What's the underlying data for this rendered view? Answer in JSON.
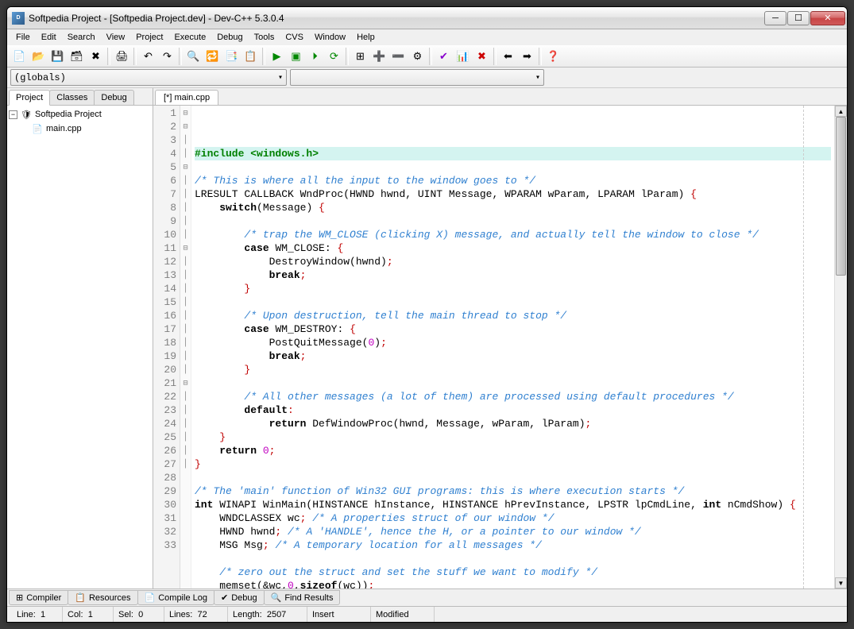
{
  "title": "Softpedia Project - [Softpedia Project.dev] - Dev-C++ 5.3.0.4",
  "menubar": [
    "File",
    "Edit",
    "Search",
    "View",
    "Project",
    "Execute",
    "Debug",
    "Tools",
    "CVS",
    "Window",
    "Help"
  ],
  "combo": {
    "globals": "(globals)"
  },
  "left_tabs": [
    "Project",
    "Classes",
    "Debug"
  ],
  "tree": {
    "root": "Softpedia Project",
    "file": "main.cpp"
  },
  "editor_tab": "[*] main.cpp",
  "bottom_tabs": [
    {
      "icon": "⊞",
      "label": "Compiler"
    },
    {
      "icon": "📋",
      "label": "Resources"
    },
    {
      "icon": "📄",
      "label": "Compile Log"
    },
    {
      "icon": "✔",
      "label": "Debug"
    },
    {
      "icon": "🔍",
      "label": "Find Results"
    }
  ],
  "status": {
    "line_label": "Line:",
    "line": "1",
    "col_label": "Col:",
    "col": "1",
    "sel_label": "Sel:",
    "sel": "0",
    "lines_label": "Lines:",
    "lines": "72",
    "length_label": "Length:",
    "length": "2507",
    "insert": "Insert",
    "modified": "Modified"
  },
  "code": [
    {
      "n": 1,
      "fold": " ",
      "t": "pre",
      "txt": "#include <windows.h>",
      "hl": true
    },
    {
      "n": 2,
      "fold": " ",
      "t": "",
      "txt": ""
    },
    {
      "n": 3,
      "fold": " ",
      "t": "cmt",
      "txt": "/* This is where all the input to the window goes to */"
    },
    {
      "n": 4,
      "fold": "⊟",
      "segs": [
        [
          "",
          "LRESULT CALLBACK WndProc(HWND hwnd, UINT Message, WPARAM wParam, LPARAM lParam) "
        ],
        [
          "op",
          "{"
        ]
      ]
    },
    {
      "n": 5,
      "fold": "⊟",
      "segs": [
        [
          "",
          "    "
        ],
        [
          "kw",
          "switch"
        ],
        [
          "",
          "(Message) "
        ],
        [
          "op",
          "{"
        ]
      ]
    },
    {
      "n": 6,
      "fold": "│",
      "t": "",
      "txt": ""
    },
    {
      "n": 7,
      "fold": "│",
      "t": "cmt",
      "txt": "        /* trap the WM_CLOSE (clicking X) message, and actually tell the window to close */"
    },
    {
      "n": 8,
      "fold": "⊟",
      "segs": [
        [
          "",
          "        "
        ],
        [
          "kw",
          "case"
        ],
        [
          "",
          " WM_CLOSE: "
        ],
        [
          "op",
          "{"
        ]
      ]
    },
    {
      "n": 9,
      "fold": "│",
      "segs": [
        [
          "",
          "            DestroyWindow(hwnd)"
        ],
        [
          "op",
          ";"
        ]
      ]
    },
    {
      "n": 10,
      "fold": "│",
      "segs": [
        [
          "",
          "            "
        ],
        [
          "kw",
          "break"
        ],
        [
          "op",
          ";"
        ]
      ]
    },
    {
      "n": 11,
      "fold": "│",
      "segs": [
        [
          "",
          "        "
        ],
        [
          "op",
          "}"
        ]
      ]
    },
    {
      "n": 12,
      "fold": "│",
      "t": "",
      "txt": ""
    },
    {
      "n": 13,
      "fold": "│",
      "t": "cmt",
      "txt": "        /* Upon destruction, tell the main thread to stop */"
    },
    {
      "n": 14,
      "fold": "⊟",
      "segs": [
        [
          "",
          "        "
        ],
        [
          "kw",
          "case"
        ],
        [
          "",
          " WM_DESTROY: "
        ],
        [
          "op",
          "{"
        ]
      ]
    },
    {
      "n": 15,
      "fold": "│",
      "segs": [
        [
          "",
          "            PostQuitMessage("
        ],
        [
          "num",
          "0"
        ],
        [
          "",
          ")"
        ],
        [
          "op",
          ";"
        ]
      ]
    },
    {
      "n": 16,
      "fold": "│",
      "segs": [
        [
          "",
          "            "
        ],
        [
          "kw",
          "break"
        ],
        [
          "op",
          ";"
        ]
      ]
    },
    {
      "n": 17,
      "fold": "│",
      "segs": [
        [
          "",
          "        "
        ],
        [
          "op",
          "}"
        ]
      ]
    },
    {
      "n": 18,
      "fold": "│",
      "t": "",
      "txt": ""
    },
    {
      "n": 19,
      "fold": "│",
      "t": "cmt",
      "txt": "        /* All other messages (a lot of them) are processed using default procedures */"
    },
    {
      "n": 20,
      "fold": "│",
      "segs": [
        [
          "",
          "        "
        ],
        [
          "kw",
          "default"
        ],
        [
          "op",
          ":"
        ]
      ]
    },
    {
      "n": 21,
      "fold": "│",
      "segs": [
        [
          "",
          "            "
        ],
        [
          "kw",
          "return"
        ],
        [
          "",
          " DefWindowProc(hwnd, Message, wParam, lParam)"
        ],
        [
          "op",
          ";"
        ]
      ]
    },
    {
      "n": 22,
      "fold": "│",
      "segs": [
        [
          "",
          "    "
        ],
        [
          "op",
          "}"
        ]
      ]
    },
    {
      "n": 23,
      "fold": "│",
      "segs": [
        [
          "",
          "    "
        ],
        [
          "kw",
          "return"
        ],
        [
          "",
          " "
        ],
        [
          "num",
          "0"
        ],
        [
          "op",
          ";"
        ]
      ]
    },
    {
      "n": 24,
      "fold": " ",
      "segs": [
        [
          "op",
          "}"
        ]
      ]
    },
    {
      "n": 25,
      "fold": " ",
      "t": "",
      "txt": ""
    },
    {
      "n": 26,
      "fold": " ",
      "t": "cmt",
      "txt": "/* The 'main' function of Win32 GUI programs: this is where execution starts */"
    },
    {
      "n": 27,
      "fold": "⊟",
      "segs": [
        [
          "kw",
          "int"
        ],
        [
          "",
          " WINAPI WinMain(HINSTANCE hInstance, HINSTANCE hPrevInstance, LPSTR lpCmdLine, "
        ],
        [
          "kw",
          "int"
        ],
        [
          "",
          " nCmdShow) "
        ],
        [
          "op",
          "{"
        ]
      ]
    },
    {
      "n": 28,
      "fold": "│",
      "segs": [
        [
          "",
          "    WNDCLASSEX wc"
        ],
        [
          "op",
          ";"
        ],
        [
          "",
          " "
        ],
        [
          "cmt",
          "/* A properties struct of our window */"
        ]
      ]
    },
    {
      "n": 29,
      "fold": "│",
      "segs": [
        [
          "",
          "    HWND hwnd"
        ],
        [
          "op",
          ";"
        ],
        [
          "",
          " "
        ],
        [
          "cmt",
          "/* A 'HANDLE', hence the H, or a pointer to our window */"
        ]
      ]
    },
    {
      "n": 30,
      "fold": "│",
      "segs": [
        [
          "",
          "    MSG Msg"
        ],
        [
          "op",
          ";"
        ],
        [
          "",
          " "
        ],
        [
          "cmt",
          "/* A temporary location for all messages */"
        ]
      ]
    },
    {
      "n": 31,
      "fold": "│",
      "t": "",
      "txt": ""
    },
    {
      "n": 32,
      "fold": "│",
      "t": "cmt",
      "txt": "    /* zero out the struct and set the stuff we want to modify */"
    },
    {
      "n": 33,
      "fold": "│",
      "segs": [
        [
          "",
          "    memset(&wc,"
        ],
        [
          "num",
          "0"
        ],
        [
          "",
          ","
        ],
        [
          "kw",
          "sizeof"
        ],
        [
          "",
          "(wc))"
        ],
        [
          "op",
          ";"
        ]
      ]
    }
  ]
}
